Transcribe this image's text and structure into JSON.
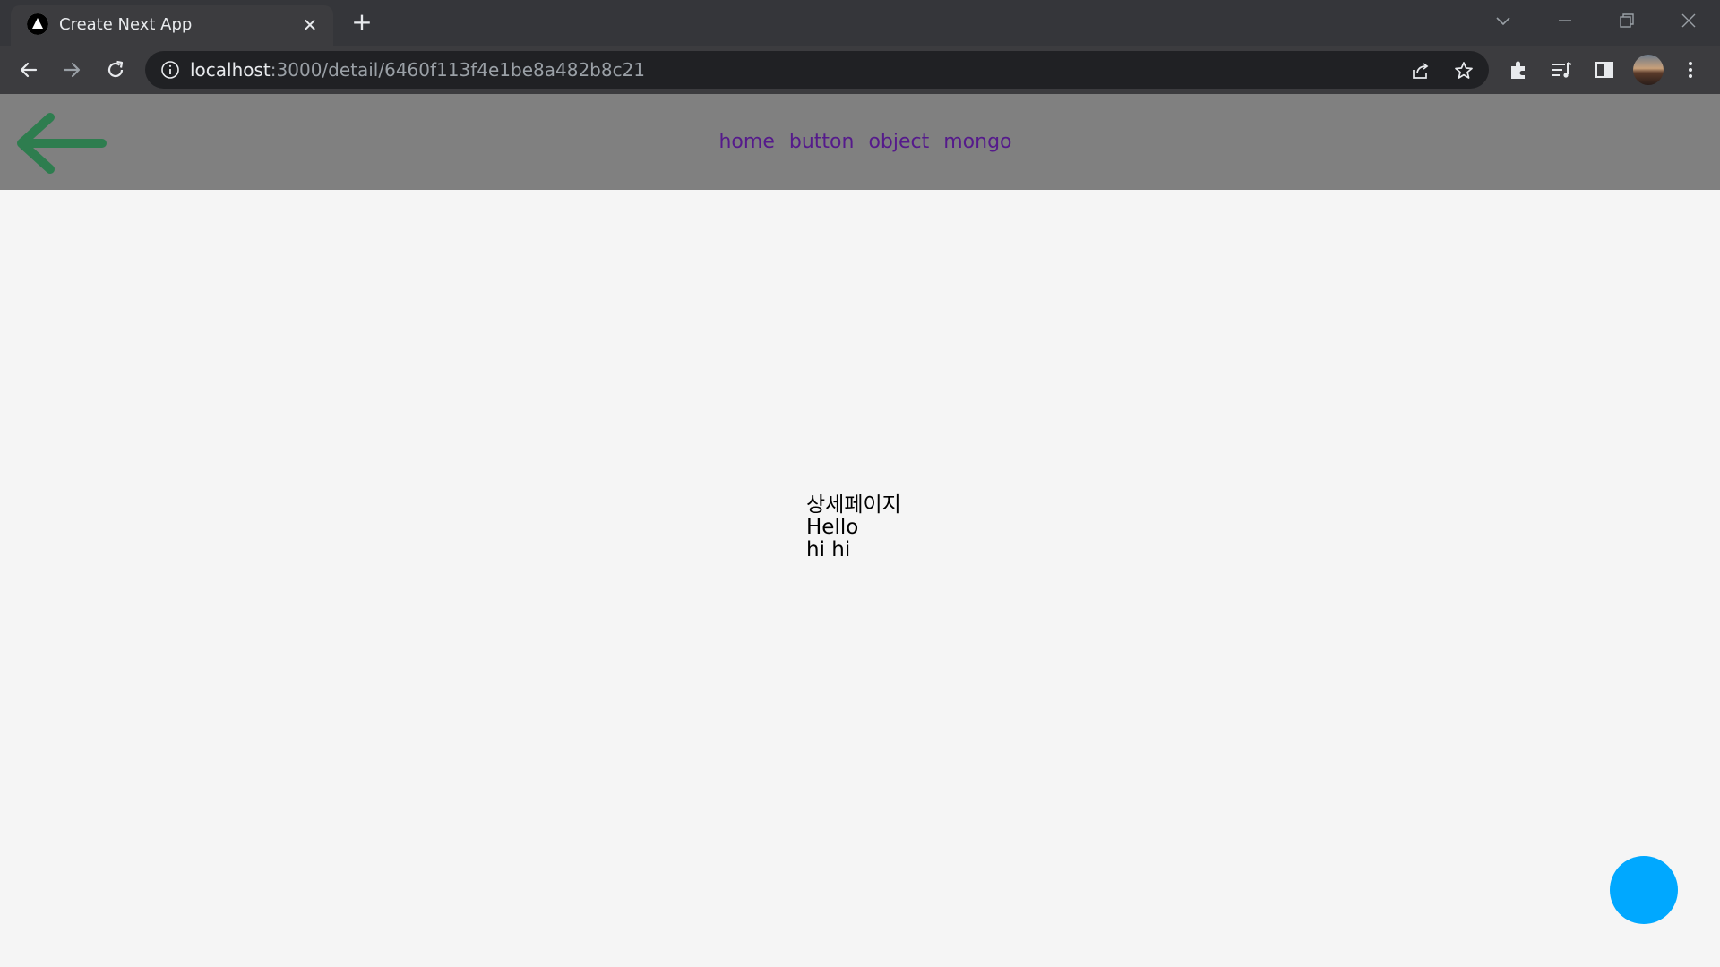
{
  "browser": {
    "tab_title": "Create Next App",
    "tab_close": "✕",
    "new_tab": "+",
    "url_host": "localhost",
    "url_path": ":3000/detail/6460f113f4e1be8a482b8c21"
  },
  "navbar": {
    "links": [
      "home",
      "button",
      "object",
      "mongo"
    ]
  },
  "content": {
    "heading": "상세페이지",
    "title": "Hello",
    "body": "hi hi"
  },
  "colors": {
    "navbar_bg": "#808080",
    "link": "#551a8b",
    "back_arrow": "#2e7d4f",
    "fab": "#00a8ff",
    "page_bg": "#f5f5f5"
  }
}
